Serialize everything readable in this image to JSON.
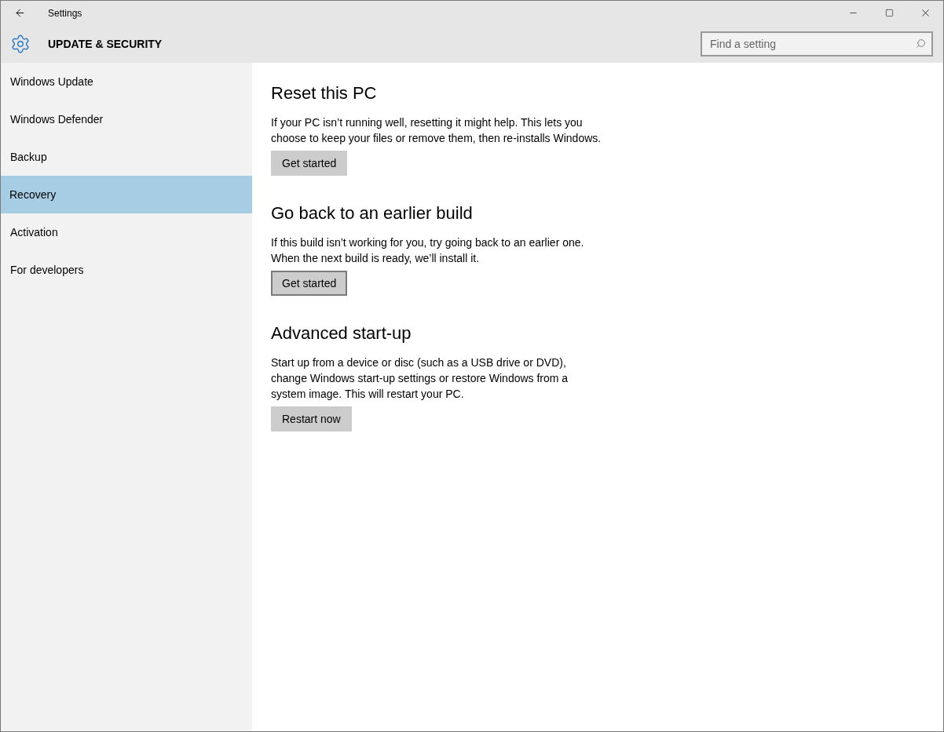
{
  "window": {
    "title": "Settings"
  },
  "header": {
    "title": "UPDATE & SECURITY",
    "search": {
      "placeholder": "Find a setting"
    }
  },
  "sidebar": {
    "items": [
      {
        "label": "Windows Update",
        "selected": false
      },
      {
        "label": "Windows Defender",
        "selected": false
      },
      {
        "label": "Backup",
        "selected": false
      },
      {
        "label": "Recovery",
        "selected": true
      },
      {
        "label": "Activation",
        "selected": false
      },
      {
        "label": "For developers",
        "selected": false
      }
    ]
  },
  "sections": [
    {
      "title": "Reset this PC",
      "text": "If your PC isn’t running well, resetting it might help. This lets you choose to keep your files or remove them, then re-installs Windows.",
      "button": {
        "label": "Get started",
        "focused": false
      }
    },
    {
      "title": "Go back to an earlier build",
      "text": "If this build isn’t working for you, try going back to an earlier one. When the next build is ready, we’ll install it.",
      "button": {
        "label": "Get started",
        "focused": true
      }
    },
    {
      "title": "Advanced start-up",
      "text": "Start up from a device or disc (such as a USB drive or DVD), change Windows start-up settings or restore Windows from a system image. This will restart your PC.",
      "button": {
        "label": "Restart now",
        "focused": false
      }
    }
  ]
}
